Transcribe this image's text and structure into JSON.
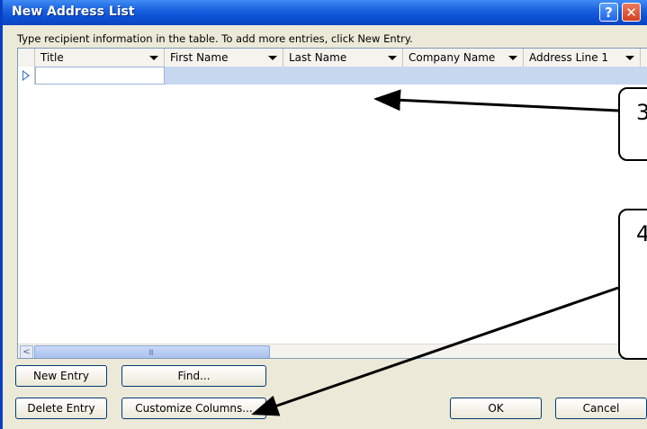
{
  "window": {
    "title": "New Address List",
    "help_label": "?",
    "close_label": "✕",
    "accent": "#0c4fd4"
  },
  "instruction": "Type recipient information in the table.  To add more entries, click New Entry.",
  "table": {
    "columns": [
      "Title",
      "First Name",
      "Last Name",
      "Company Name",
      "Address Line 1"
    ],
    "header_arrow_icon": "dropdown-arrow-icon",
    "row_selector_icon": "row-pointer-icon",
    "selected_row_color": "#c8d7f0"
  },
  "scrollbar": {
    "left_arrow": "<",
    "grip": "III"
  },
  "buttons": {
    "new_entry": "New Entry",
    "find": "Find...",
    "delete_entry": "Delete Entry",
    "customize_columns": "Customize Columns...",
    "ok": "OK",
    "cancel": "Cancel"
  },
  "callouts": [
    {
      "label": "3"
    },
    {
      "label": "4"
    }
  ]
}
